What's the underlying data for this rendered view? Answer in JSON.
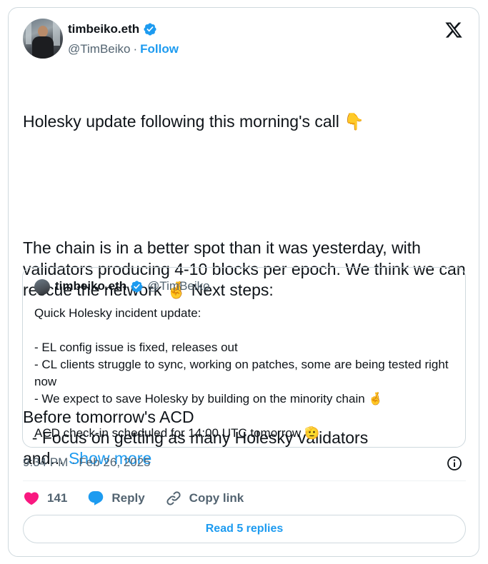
{
  "author": {
    "display_name": "timbeiko.eth",
    "handle": "@TimBeiko",
    "separator": "·",
    "follow_label": "Follow",
    "verified": true
  },
  "tweet": {
    "line1": "Holesky update following this morning's call ",
    "emoji1": "👇",
    "para2": "The chain is in a better spot than it was yesterday, with validators producing 4-10 blocks per epoch. We think we can rescue the network ",
    "emoji2": "🤞",
    "para2_end": " Next steps:",
    "para3": "Before tomorrow's ACD\n  - Focus on getting as many Holesky validators\nand...",
    "show_more": "Show more"
  },
  "quote": {
    "display_name": "timbeiko.eth",
    "handle": "@TimBeiko",
    "text": "Quick Holesky incident update:\n\n- EL config issue is fixed, releases out\n- CL clients struggle to sync, working on patches, some are being tested right now\n- We expect to save Holesky by building on the minority chain ",
    "emoji1": "🤞",
    "text2": "\n\nACD check-in scheduled for 14:00 UTC tomorrow ",
    "emoji2": "🫡"
  },
  "timestamp": "9:34 PM · Feb 26, 2025",
  "actions": {
    "like_count": "141",
    "reply_label": "Reply",
    "copy_link_label": "Copy link"
  },
  "read_replies_label": "Read 5 replies",
  "colors": {
    "accent": "#1d9bf0",
    "like": "#f91880",
    "muted": "#536471",
    "border": "#cfd9de"
  }
}
